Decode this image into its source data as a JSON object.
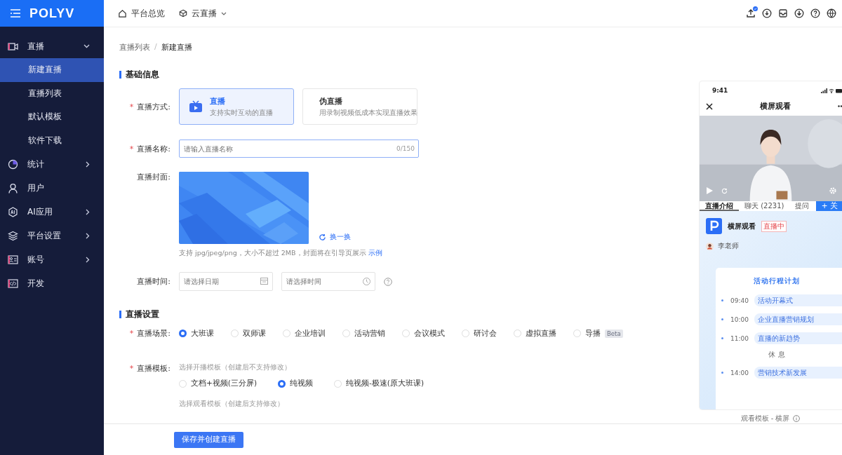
{
  "logo": "POLYV",
  "required_mark": "*",
  "top_nav": [
    {
      "label": "平台总览",
      "kind": "home",
      "dropdown": false
    },
    {
      "label": "云直播",
      "kind": "cube",
      "dropdown": true
    }
  ],
  "toolbar_icons": [
    {
      "kind": "upload",
      "badge": true
    },
    {
      "kind": "download",
      "badge": false
    },
    {
      "kind": "inbox",
      "badge": false
    },
    {
      "kind": "download-circle",
      "badge": false
    },
    {
      "kind": "help",
      "badge": false
    },
    {
      "kind": "globe",
      "badge": false
    }
  ],
  "sidebar": {
    "items": [
      {
        "label": "直播",
        "kind": "live",
        "expanded": true,
        "children": [
          {
            "label": "新建直播",
            "selected": true
          },
          {
            "label": "直播列表",
            "selected": false
          },
          {
            "label": "默认模板",
            "selected": false
          },
          {
            "label": "软件下载",
            "selected": false
          }
        ]
      },
      {
        "label": "统计",
        "kind": "chart",
        "expanded": false
      },
      {
        "label": "用户",
        "kind": "user"
      },
      {
        "label": "AI应用",
        "kind": "ai",
        "expanded": false
      },
      {
        "label": "平台设置",
        "kind": "layers",
        "expanded": false
      },
      {
        "label": "账号",
        "kind": "card",
        "expanded": false
      },
      {
        "label": "开发",
        "kind": "code"
      }
    ]
  },
  "breadcrumb": {
    "items": [
      "直播列表",
      "新建直播"
    ],
    "separator": "/"
  },
  "basic_info": {
    "title": "基础信息",
    "mode": {
      "label": "直播方式:",
      "required": true,
      "options": [
        {
          "kind": "live",
          "title": "直播",
          "desc": "支持实时互动的直播",
          "selected": true
        },
        {
          "kind": "pseudo",
          "title": "伪直播",
          "desc": "用录制视频低成本实现直播效果",
          "selected": false
        }
      ]
    },
    "name": {
      "label": "直播名称:",
      "required": true,
      "placeholder": "请输入直播名称",
      "counter": "0/150"
    },
    "cover": {
      "label": "直播封面:",
      "required": false,
      "change": "换一换",
      "hint": "支持 jpg/jpeg/png，大小不超过 2MB，封面将在引导页展示",
      "hint_link": "示例"
    },
    "time": {
      "label": "直播时间:",
      "required": false,
      "date_placeholder": "请选择日期",
      "time_placeholder": "请选择时间"
    }
  },
  "live_settings": {
    "title": "直播设置",
    "scene": {
      "label": "直播场景:",
      "required": true,
      "options": [
        {
          "label": "大班课",
          "selected": true
        },
        {
          "label": "双师课",
          "selected": false
        },
        {
          "label": "企业培训",
          "selected": false
        },
        {
          "label": "活动营销",
          "selected": false
        },
        {
          "label": "会议模式",
          "selected": false
        },
        {
          "label": "研讨会",
          "selected": false
        },
        {
          "label": "虚拟直播",
          "selected": false
        },
        {
          "label": "导播",
          "selected": false,
          "badge": "Beta"
        }
      ]
    },
    "template": {
      "label": "直播模板:",
      "required": true,
      "note": "选择开播模板（创建后不支持修改）",
      "options": [
        {
          "label": "文档+视频(三分屏)",
          "selected": false
        },
        {
          "label": "纯视频",
          "selected": true
        },
        {
          "label": "纯视频-极速(原大班课)",
          "selected": false
        }
      ],
      "watch_note": "选择观看模板（创建后支持修改）"
    }
  },
  "footer": {
    "save_button": "保存并创建直播"
  },
  "preview": {
    "time": "9:41",
    "title": "横屏观看",
    "tabs": [
      {
        "label": "直播介绍",
        "selected": true
      },
      {
        "label": "聊天 (2231)",
        "selected": false
      },
      {
        "label": "提问",
        "selected": false
      }
    ],
    "follow": "+ 关",
    "channel": "横屏观看",
    "status": "直播中",
    "host": "李老师",
    "schedule_title": "活动行程计划",
    "schedule": [
      {
        "kind": "item",
        "time": "09:40",
        "title": "活动开幕式"
      },
      {
        "kind": "item",
        "time": "10:00",
        "title": "企业直播营销规划"
      },
      {
        "kind": "item",
        "time": "11:00",
        "title": "直播的新趋势"
      },
      {
        "kind": "break",
        "title": "休 息"
      },
      {
        "kind": "item",
        "time": "14:00",
        "title": "营销技术新发展"
      }
    ],
    "caption": "观看模板 - 横屏"
  }
}
